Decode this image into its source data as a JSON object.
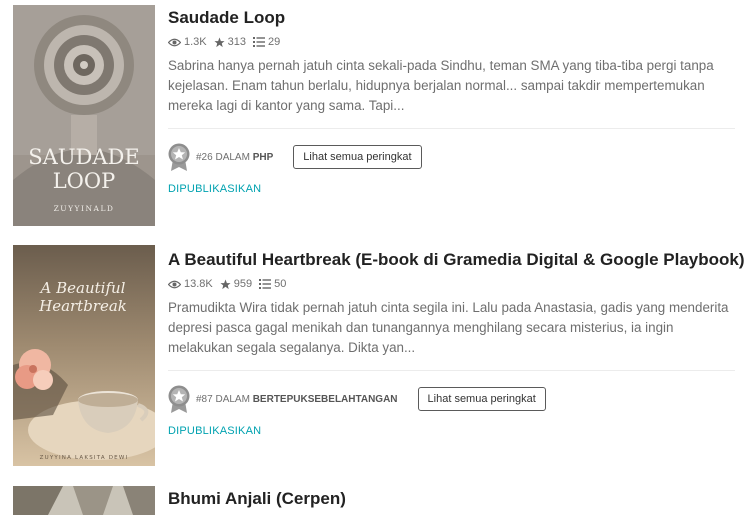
{
  "stories": [
    {
      "title": "Saudade Loop",
      "reads": "1.3K",
      "votes": "313",
      "parts": "29",
      "description": "Sabrina hanya pernah jatuh cinta sekali-pada Sindhu, teman SMA yang tiba-tiba pergi tanpa kejelasan. Enam tahun berlalu, hidupnya berjalan normal... sampai takdir mempertemukan mereka lagi di kantor yang sama. Tapi...",
      "rank_number": "#26",
      "rank_word": "DALAM",
      "rank_tag": "PHP",
      "rank_button": "Lihat semua peringkat",
      "status": "DIPUBLIKASIKAN",
      "cover_title_1": "SAUDADE",
      "cover_title_2": "LOOP",
      "cover_author": "ZUYYINALD"
    },
    {
      "title": "A Beautiful Heartbreak (E-book di Gramedia Digital & Google Playbook)",
      "reads": "13.8K",
      "votes": "959",
      "parts": "50",
      "description": "Pramudikta Wira tidak pernah jatuh cinta segila ini. Lalu pada Anastasia, gadis yang menderita depresi pasca gagal menikah dan tunangannya menghilang secara misterius, ia ingin melakukan segala segalanya. Dikta yan...",
      "rank_number": "#87",
      "rank_word": "DALAM",
      "rank_tag": "BERTEPUKSEBELAHTANGAN",
      "rank_button": "Lihat semua peringkat",
      "status": "DIPUBLIKASIKAN",
      "cover_title_1": "A Beautiful",
      "cover_title_2": "Heartbreak",
      "cover_author": "ZUYYINA LAKSITA DEWI"
    },
    {
      "title": "Bhumi Anjali (Cerpen)"
    }
  ],
  "icons": {
    "reads": "eye-icon",
    "votes": "star-icon",
    "parts": "list-icon",
    "rank": "ranking-medal-icon"
  },
  "colors": {
    "status": "#00a2b0",
    "text_muted": "#6f6f6f",
    "medal": "#8e8e8e"
  }
}
